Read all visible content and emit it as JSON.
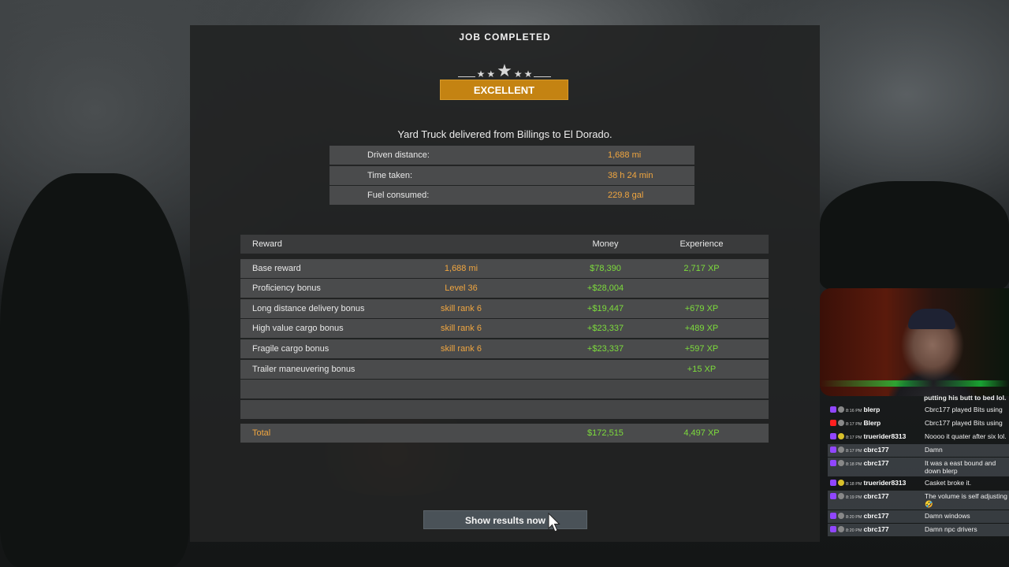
{
  "title": "JOB COMPLETED",
  "rating": "EXCELLENT",
  "summary": "Yard Truck delivered from Billings to El Dorado.",
  "stats": [
    {
      "label": "Driven distance:",
      "value": "1,688 mi"
    },
    {
      "label": "Time taken:",
      "value": "38 h 24 min"
    },
    {
      "label": "Fuel consumed:",
      "value": "229.8 gal"
    }
  ],
  "rewards": {
    "headers": {
      "reward": "Reward",
      "money": "Money",
      "experience": "Experience"
    },
    "rows": [
      {
        "name": "Base reward",
        "detail": "1,688 mi",
        "money": "$78,390",
        "xp": "2,717 XP"
      },
      {
        "name": "Proficiency bonus",
        "detail": "Level 36",
        "money": "+$28,004",
        "xp": ""
      },
      {
        "name": "Long distance delivery bonus",
        "detail": "skill rank 6",
        "money": "+$19,447",
        "xp": "+679 XP"
      },
      {
        "name": "High value cargo bonus",
        "detail": "skill rank 6",
        "money": "+$23,337",
        "xp": "+489 XP"
      },
      {
        "name": "Fragile cargo bonus",
        "detail": "skill rank 6",
        "money": "+$23,337",
        "xp": "+597 XP"
      },
      {
        "name": "Trailer maneuvering bonus",
        "detail": "",
        "money": "",
        "xp": "+15 XP"
      }
    ],
    "total": {
      "name": "Total",
      "money": "$172,515",
      "xp": "4,497 XP"
    }
  },
  "show_results_label": "Show results now",
  "chat": {
    "top_message": "putting his butt to bed lol.",
    "messages": [
      {
        "time": "8:16 PM",
        "user": "blerp",
        "msg": "Cbrc177 played Bits using",
        "platform": "twitch",
        "highlight": false
      },
      {
        "time": "8:17 PM",
        "user": "Blerp",
        "msg": "Cbrc177 played Bits using",
        "platform": "youtube",
        "highlight": false
      },
      {
        "time": "8:17 PM",
        "user": "truerider8313",
        "msg": "Noooo it quater after six lol.",
        "platform": "twitch",
        "highlight": false
      },
      {
        "time": "8:17 PM",
        "user": "cbrc177",
        "msg": "Damn",
        "platform": "twitch",
        "highlight": true
      },
      {
        "time": "8:18 PM",
        "user": "cbrc177",
        "msg": "It was a east bound and down blerp",
        "platform": "twitch",
        "highlight": true
      },
      {
        "time": "8:18 PM",
        "user": "truerider8313",
        "msg": "Casket broke it.",
        "platform": "twitch",
        "highlight": false
      },
      {
        "time": "8:19 PM",
        "user": "cbrc177",
        "msg": "The volume is self adjusting 🤣",
        "platform": "twitch",
        "highlight": true
      },
      {
        "time": "8:20 PM",
        "user": "cbrc177",
        "msg": "Damn windows",
        "platform": "twitch",
        "highlight": true
      },
      {
        "time": "8:20 PM",
        "user": "cbrc177",
        "msg": "Damn npc drivers",
        "platform": "twitch",
        "highlight": true
      }
    ]
  },
  "colors": {
    "accent_gold": "#c48312",
    "value_orange": "#f0a640",
    "value_green": "#7ddc3c"
  }
}
